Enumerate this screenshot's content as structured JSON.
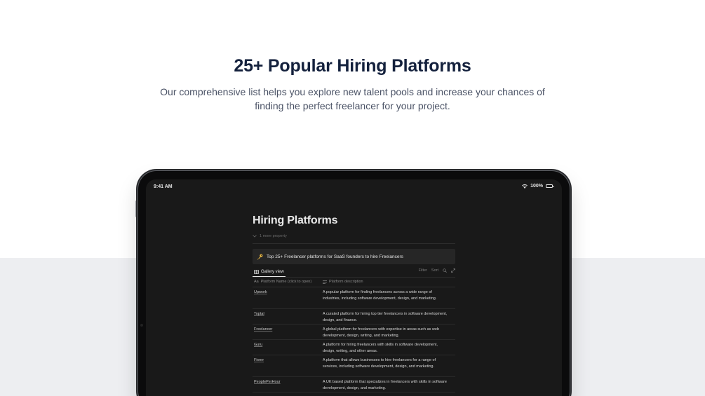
{
  "hero": {
    "title": "25+ Popular Hiring Platforms",
    "subtitle": "Our comprehensive list helps you explore new talent pools and increase your chances of finding the perfect freelancer for your project."
  },
  "status_bar": {
    "time": "9:41 AM",
    "battery": "100%"
  },
  "page": {
    "title": "Hiring Platforms",
    "more_property": "1 more property",
    "callout_icon": "key-icon",
    "callout_text": "Top 25+ Freelancer platforms for SaaS founders to hire Freelancers"
  },
  "view": {
    "tab_label": "Gallery view",
    "filter_label": "Filter",
    "sort_label": "Sort"
  },
  "table": {
    "col_name": "Platform Name (click to open)",
    "col_name_prefix": "Aa",
    "col_desc": "Platform description",
    "rows": [
      {
        "name": "Upwork",
        "description": "A popular platform for finding freelancers across a wide range of industries, including software development, design, and marketing."
      },
      {
        "name": "Toptal",
        "description": "A curated platform for hiring top tier freelancers in software development, design, and finance."
      },
      {
        "name": "Freelancer",
        "description": "A global platform for freelancers with expertise in areas such as web development, design, writing, and marketing."
      },
      {
        "name": "Guru",
        "description": "A platform for hiring freelancers with skills in software development, design, writing, and other areas."
      },
      {
        "name": "Fiverr",
        "description": "A platform that allows businesses to hire freelancers for a range of services, including software development, design, and marketing."
      },
      {
        "name": "PeoplePerHour",
        "description": "A UK based platform that specializes in freelancers with skills in software development, design, and marketing."
      }
    ]
  }
}
